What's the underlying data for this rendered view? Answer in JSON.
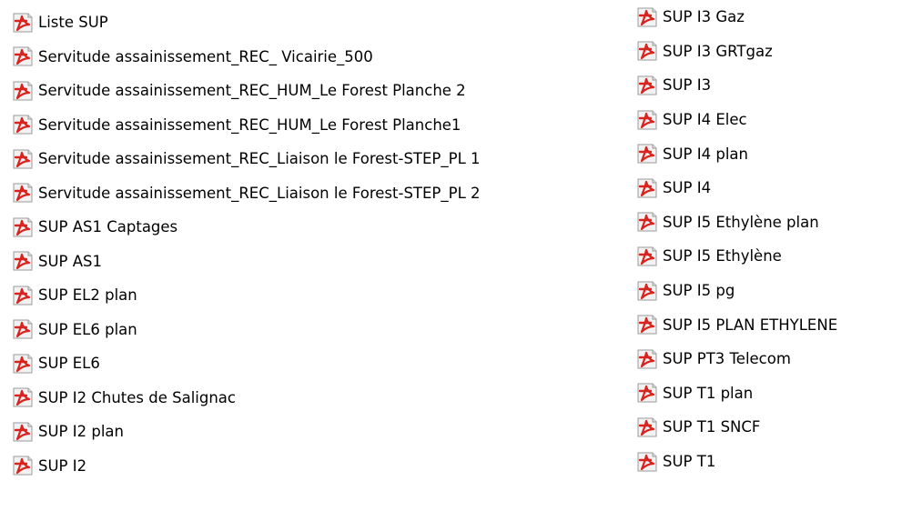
{
  "files": {
    "left_column": [
      {
        "name": "Liste SUP",
        "icon": "pdf-icon"
      },
      {
        "name": "Servitude assainissement_REC_ Vicairie_500",
        "icon": "pdf-icon"
      },
      {
        "name": "Servitude assainissement_REC_HUM_Le Forest Planche 2",
        "icon": "pdf-icon"
      },
      {
        "name": "Servitude assainissement_REC_HUM_Le Forest Planche1",
        "icon": "pdf-icon"
      },
      {
        "name": "Servitude assainissement_REC_Liaison le Forest-STEP_PL 1",
        "icon": "pdf-icon"
      },
      {
        "name": "Servitude assainissement_REC_Liaison le Forest-STEP_PL 2",
        "icon": "pdf-icon"
      },
      {
        "name": "SUP AS1 Captages",
        "icon": "pdf-icon"
      },
      {
        "name": "SUP AS1",
        "icon": "pdf-icon"
      },
      {
        "name": "SUP EL2 plan",
        "icon": "pdf-icon"
      },
      {
        "name": "SUP EL6 plan",
        "icon": "pdf-icon"
      },
      {
        "name": "SUP EL6",
        "icon": "pdf-icon"
      },
      {
        "name": "SUP I2 Chutes de Salignac",
        "icon": "pdf-icon"
      },
      {
        "name": "SUP I2 plan",
        "icon": "pdf-icon"
      },
      {
        "name": "SUP I2",
        "icon": "pdf-icon"
      }
    ],
    "right_column": [
      {
        "name": "SUP I3 Gaz",
        "icon": "pdf-icon"
      },
      {
        "name": "SUP I3 GRTgaz",
        "icon": "pdf-icon"
      },
      {
        "name": "SUP I3",
        "icon": "pdf-icon"
      },
      {
        "name": "SUP I4 Elec",
        "icon": "pdf-icon"
      },
      {
        "name": "SUP I4 plan",
        "icon": "pdf-icon"
      },
      {
        "name": "SUP I4",
        "icon": "pdf-icon"
      },
      {
        "name": "SUP I5 Ethylène plan",
        "icon": "pdf-icon"
      },
      {
        "name": "SUP I5 Ethylène",
        "icon": "pdf-icon"
      },
      {
        "name": "SUP I5 pg",
        "icon": "pdf-icon"
      },
      {
        "name": "SUP I5 PLAN ETHYLENE",
        "icon": "pdf-icon"
      },
      {
        "name": "SUP PT3 Telecom",
        "icon": "pdf-icon"
      },
      {
        "name": "SUP T1 plan",
        "icon": "pdf-icon"
      },
      {
        "name": "SUP T1 SNCF",
        "icon": "pdf-icon"
      },
      {
        "name": "SUP T1",
        "icon": "pdf-icon"
      }
    ]
  },
  "colors": {
    "pdf_icon_red": "#d9231e",
    "pdf_icon_page": "#f2f2f2",
    "pdf_icon_border": "#9a9a9a",
    "text": "#000000",
    "background": "#ffffff"
  }
}
